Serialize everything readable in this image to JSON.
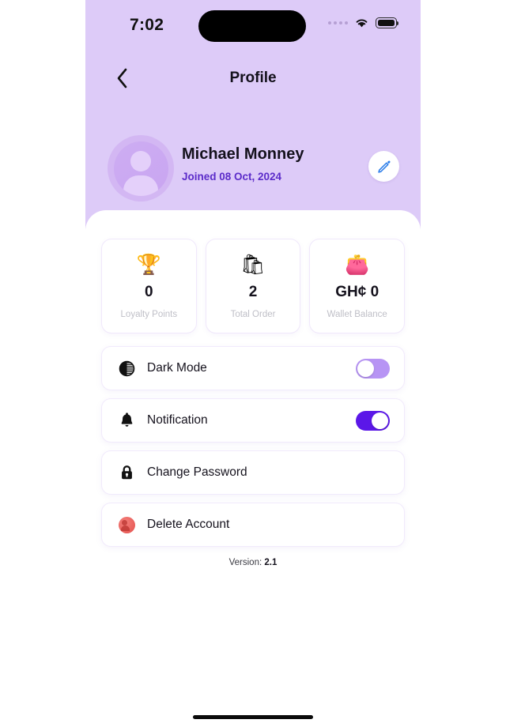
{
  "status_bar": {
    "time": "7:02",
    "signal_icon": "signal-dots-icon",
    "wifi_icon": "wifi-icon",
    "battery_icon": "battery-icon"
  },
  "navbar": {
    "back_icon": "chevron-left-icon",
    "title": "Profile"
  },
  "profile": {
    "avatar_icon": "user-avatar-icon",
    "name": "Michael Monney",
    "joined": "Joined 08 Oct, 2024",
    "edit_icon": "pencil-edit-icon"
  },
  "stats": [
    {
      "icon": "🏆",
      "icon_name": "trophy-icon",
      "value": "0",
      "label": "Loyalty Points"
    },
    {
      "icon": "🛍",
      "icon_name": "shopping-bag-icon",
      "value": "2",
      "label": "Total Order"
    },
    {
      "icon": "👛",
      "icon_name": "wallet-icon",
      "value": "GH¢ 0",
      "label": "Wallet Balance"
    }
  ],
  "settings": [
    {
      "label": "Dark Mode",
      "icon_name": "contrast-icon",
      "control": "toggle",
      "state": "off"
    },
    {
      "label": "Notification",
      "icon_name": "bell-icon",
      "control": "toggle",
      "state": "on"
    },
    {
      "label": "Change Password",
      "icon_name": "lock-icon",
      "control": "none"
    },
    {
      "label": "Delete Account",
      "icon_name": "delete-account-icon",
      "control": "none"
    }
  ],
  "footer": {
    "version_label": "Version:",
    "version_value": "2.1"
  },
  "colors": {
    "header_purple": "#ddcbf8",
    "accent_purple": "#5b17e8",
    "toggle_off": "#b794f4",
    "joined_text": "#5b2bc9",
    "danger_red": "#e4504c",
    "edit_blue": "#2b7de9"
  }
}
